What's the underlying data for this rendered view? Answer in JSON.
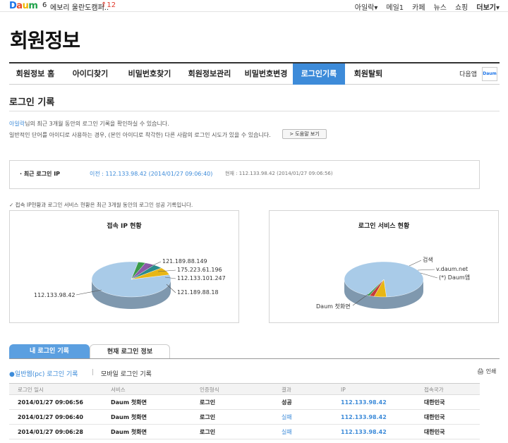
{
  "topbar": {
    "logo": [
      "D",
      "a",
      "u",
      "m"
    ],
    "issue_rank": "6",
    "issue_text": "에보리 울란도캠퍼..",
    "rank_change": "↑12",
    "links": [
      "아일락▾",
      "메일1",
      "카페",
      "뉴스",
      "쇼핑",
      "더보기▾"
    ]
  },
  "page_title": "회원정보",
  "tabs": [
    {
      "label": "회원정보 홈"
    },
    {
      "label": "아이디찾기"
    },
    {
      "label": "비밀번호찾기"
    },
    {
      "label": "회원정보관리"
    },
    {
      "label": "비밀번호변경"
    },
    {
      "label": "로그인기록"
    },
    {
      "label": "회원탈퇴"
    }
  ],
  "other_apps_label": "다음앱",
  "app_icon_label": "Daum",
  "section_title": "로그인 기록",
  "desc": {
    "user": "아일락",
    "line1_rest": "님의 최근 3개월 동안의 로그인 기록을 확인하실 수 있습니다.",
    "line2": "일반적인 단어를 아이디로 사용하는 경우, (본인 아이디로 착각한) 다른 사람의 로그인 시도가 있을 수 있습니다.",
    "help_button": "> 도움말 보기"
  },
  "recent": {
    "label": "· 최근 로그인 IP",
    "previous": "이전 : 112.133.98.42 (2014/01/27 09:06:40)",
    "current": "현재 : 112.133.98.42 (2014/01/27 09:06:56)"
  },
  "notice": "✓ 접속 IP현황과 로그인 서비스 현황은 최근 3개월 동안의 로그인 성공 기록입니다.",
  "colors": {
    "accent": "#3d8bd9",
    "pie_main": "#a9cbe8",
    "pie_yellow": "#e8b614",
    "pie_red": "#c63a3a",
    "pie_green": "#3a9b4a",
    "pie_purple": "#8a5aa8",
    "pie_teal": "#2a8c8c"
  },
  "chart_data": [
    {
      "type": "pie",
      "title": "접속 IP 현황",
      "labels": [
        "112.133.98.42",
        "121.189.88.149",
        "175.223.61.196",
        "112.133.101.247",
        "121.189.88.18"
      ],
      "values": [
        82,
        3,
        4,
        4,
        7
      ]
    },
    {
      "type": "pie",
      "title": "로그인 서비스 현황",
      "labels": [
        "Daum 첫화면",
        "검색",
        "v.daum.net",
        "(*) Daum앱"
      ],
      "values": [
        92,
        5,
        2,
        1
      ]
    }
  ],
  "subtabs": {
    "active": "내 로그인 기록",
    "inactive": "현재 로그인 정보"
  },
  "filters": {
    "pc": "●일반웹(pc) 로그인 기록",
    "sep": "|",
    "mobile": "모바일 로그인 기록",
    "print": "🖨 인쇄"
  },
  "table": {
    "headers": [
      "로그인 일시",
      "서비스",
      "인증형식",
      "결과",
      "IP",
      "접속국가"
    ],
    "rows": [
      [
        "2014/01/27 09:06:56",
        "Daum 첫화면",
        "로그인",
        "성공",
        "112.133.98.42",
        "대한민국"
      ],
      [
        "2014/01/27 09:06:40",
        "Daum 첫화면",
        "로그인",
        "실패",
        "112.133.98.42",
        "대한민국"
      ],
      [
        "2014/01/27 09:06:28",
        "Daum 첫화면",
        "로그인",
        "실패",
        "112.133.98.42",
        "대한민국"
      ]
    ]
  }
}
